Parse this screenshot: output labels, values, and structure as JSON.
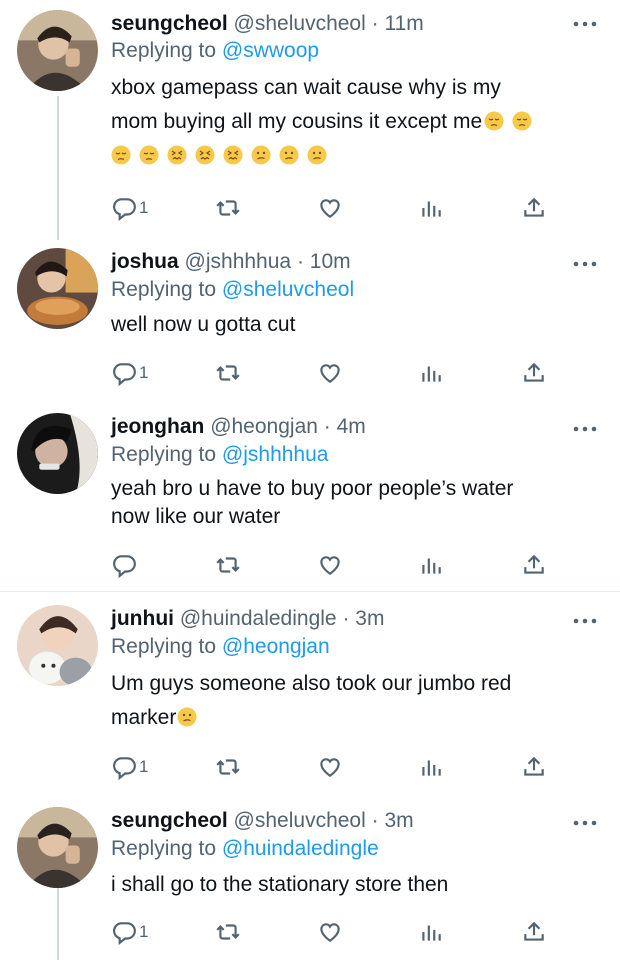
{
  "tweets": [
    {
      "name": "seungcheol",
      "handle": "@sheluvcheol",
      "time": "11m",
      "replying_label": "Replying to",
      "replying_to": "@swwoop",
      "line1": "xbox gamepass can wait cause why is my",
      "line2": "mom buying all my cousins it except me",
      "emojis_line2": [
        "pensive-face",
        "pensive-face"
      ],
      "emojis_line3": [
        "pensive-face",
        "pensive-face",
        "confounded-face",
        "confounded-face",
        "confounded-face",
        "confused-face",
        "confused-face",
        "confused-face"
      ],
      "reply_count": "1"
    },
    {
      "name": "joshua",
      "handle": "@jshhhhua",
      "time": "10m",
      "replying_label": "Replying to",
      "replying_to": "@sheluvcheol",
      "line1": "well now u gotta cut",
      "reply_count": "1"
    },
    {
      "name": "jeonghan",
      "handle": "@heongjan",
      "time": "4m",
      "replying_label": "Replying to",
      "replying_to": "@jshhhhua",
      "line1": "yeah bro u have to buy poor people’s water",
      "line2": "now like our water",
      "reply_count": ""
    },
    {
      "name": "junhui",
      "handle": "@huindaledingle",
      "time": "3m",
      "replying_label": "Replying to",
      "replying_to": "@heongjan",
      "line1": "Um guys someone also took our jumbo red",
      "line2": "marker",
      "emojis_line2": [
        "confused-face"
      ],
      "reply_count": "1"
    },
    {
      "name": "seungcheol",
      "handle": "@sheluvcheol",
      "time": "3m",
      "replying_label": "Replying to",
      "replying_to": "@huindaledingle",
      "line1": "i shall go to the stationary store then",
      "reply_count": "1"
    }
  ],
  "separator": "·",
  "icons": [
    "reply-icon",
    "retweet-icon",
    "like-icon",
    "analytics-icon",
    "share-icon",
    "more-icon"
  ],
  "colors": {
    "link": "#1d9bf0",
    "muted": "#536471",
    "text": "#0f1419",
    "thread": "#cfd9de"
  }
}
